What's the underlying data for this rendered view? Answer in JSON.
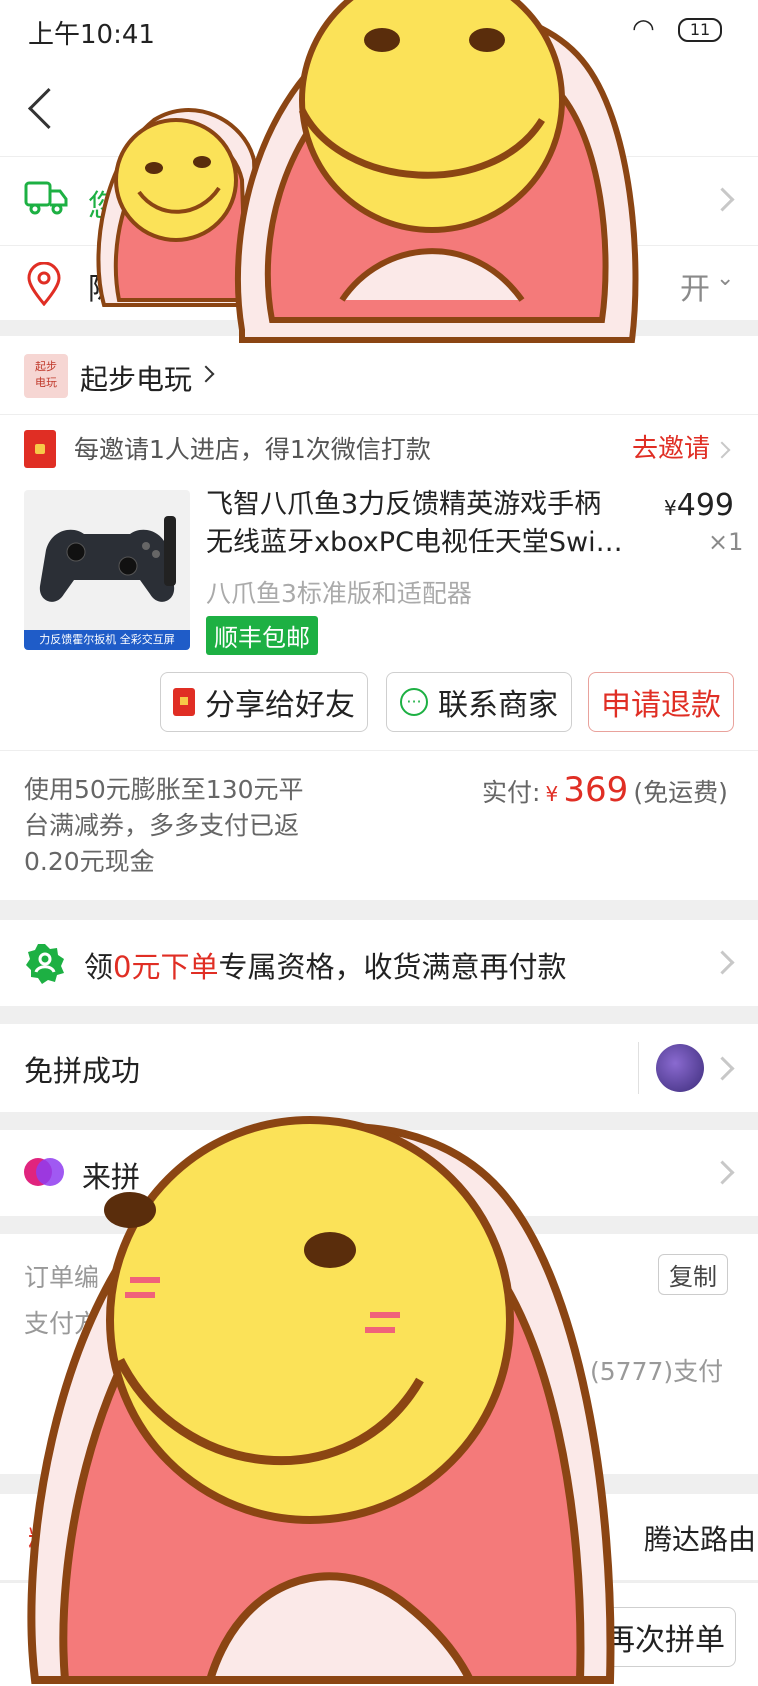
{
  "status_bar": {
    "time": "上午10:41",
    "battery": "11"
  },
  "delivery": {
    "text": "您"
  },
  "address": {
    "text": "陈",
    "expand_label": "开"
  },
  "store": {
    "logo_text": "起步\n电玩",
    "name": "起步电玩"
  },
  "invite": {
    "text": "每邀请1人进店，得1次微信打款",
    "action": "去邀请"
  },
  "product": {
    "title": "飞智八爪鱼3力反馈精英游戏手柄无线蓝牙xboxPC电视任天堂Swi…",
    "price": "499",
    "qty": "×1",
    "variant": "八爪鱼3标准版和适配器",
    "shipping_badge": "顺丰包邮",
    "image_caption": "力反馈霍尔扳机  全彩交互屏"
  },
  "actions": {
    "share": "分享给好友",
    "contact": "联系商家",
    "refund": "申请退款"
  },
  "payment": {
    "coupon_note": "使用50元膨胀至130元平台满减券，多多支付已返0.20元现金",
    "paid_label": "实付:",
    "currency": "¥",
    "paid_amount": "369",
    "shipping_note": "(免运费)"
  },
  "promo": {
    "pre": "领",
    "highlight": "0元下单",
    "post": "专属资格，收货满意再付款"
  },
  "group": {
    "title": "免拼成功"
  },
  "lai": {
    "title": "来拼"
  },
  "order_info": {
    "order_label": "订单编",
    "copy": "复制",
    "pay_label": "支付方",
    "pay_value": "(5777)支付"
  },
  "bottom": {
    "tab_left": "精",
    "tab_right": "腾达路由",
    "reorder": "再次拼单"
  },
  "colors": {
    "accent": "#e02e24",
    "green": "#1db043"
  }
}
